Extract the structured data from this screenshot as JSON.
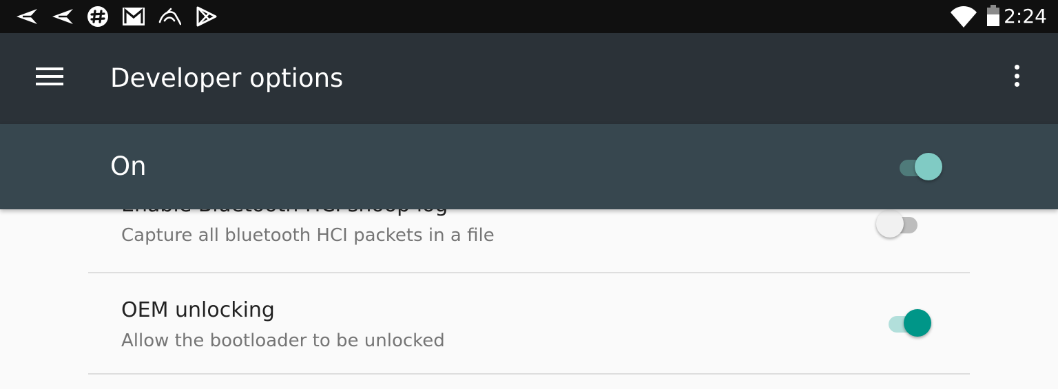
{
  "status_bar": {
    "time": "2:24",
    "left_icons": [
      "send-icon",
      "send-icon",
      "slack-icon",
      "gmail-icon",
      "kali-dragon-icon",
      "play-store-icon"
    ],
    "right_icons": [
      "wifi-icon",
      "battery-icon"
    ]
  },
  "toolbar": {
    "title": "Developer options",
    "menu_icon": "hamburger-menu-icon",
    "overflow_icon": "more-vert-icon"
  },
  "master_switch": {
    "label": "On",
    "checked": true
  },
  "settings": [
    {
      "title": "Enable Bluetooth HCI snoop log",
      "summary": "Capture all bluetooth HCI packets in a file",
      "checked": false
    },
    {
      "title": "OEM unlocking",
      "summary": "Allow the bootloader to be unlocked",
      "checked": true
    }
  ],
  "colors": {
    "status_bar": "#101010",
    "toolbar": "#2b3238",
    "master_bar": "#37474f",
    "accent": "#009688",
    "accent_light": "#80cbc4"
  }
}
